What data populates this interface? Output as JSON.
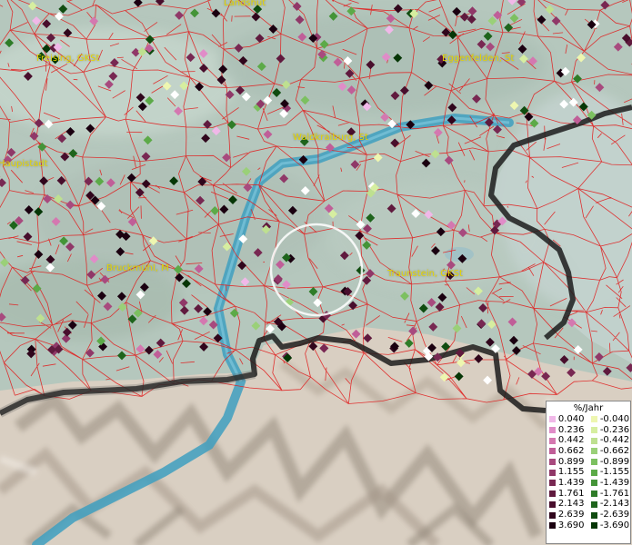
{
  "map": {
    "place_labels": [
      {
        "id": "landshut",
        "text": "Landshut"
      },
      {
        "id": "freising",
        "text": "Freising, GKSt"
      },
      {
        "id": "eggenfelden",
        "text": "Eggenfelden, St"
      },
      {
        "id": "waldkraiburg",
        "text": "Waldkraiburg, St"
      },
      {
        "id": "haupstadt",
        "text": "Haupistadt"
      },
      {
        "id": "bruckmuehl",
        "text": "Bruckmühl, M"
      },
      {
        "id": "traunstein",
        "text": "Traunstein, GKSt"
      }
    ],
    "colors": {
      "terrain_base": "#b8cac2",
      "boundary_lines": "#e02020",
      "river": "#3e9fc0",
      "state_border": "#1c1c1c",
      "selection_circle": "#ffffff"
    }
  },
  "legend": {
    "title": "%/Jahr",
    "rows": [
      {
        "pos": "0.040",
        "pos_color": "#f0b8e8",
        "neg": "-0.040",
        "neg_color": "#eef6b0"
      },
      {
        "pos": "0.236",
        "pos_color": "#e08cc8",
        "neg": "-0.236",
        "neg_color": "#d6eea0"
      },
      {
        "pos": "0.442",
        "pos_color": "#d478b0",
        "neg": "-0.442",
        "neg_color": "#bee090"
      },
      {
        "pos": "0.662",
        "pos_color": "#c05e98",
        "neg": "-0.662",
        "neg_color": "#9ad078"
      },
      {
        "pos": "0.899",
        "pos_color": "#a84a7e",
        "neg": "-0.899",
        "neg_color": "#7cc060"
      },
      {
        "pos": "1.155",
        "pos_color": "#903868",
        "neg": "-1.155",
        "neg_color": "#5caa48"
      },
      {
        "pos": "1.439",
        "pos_color": "#782852",
        "neg": "-1.439",
        "neg_color": "#449438"
      },
      {
        "pos": "1.761",
        "pos_color": "#601a3e",
        "neg": "-1.761",
        "neg_color": "#2e7c28"
      },
      {
        "pos": "2.143",
        "pos_color": "#480e2c",
        "neg": "-2.143",
        "neg_color": "#1e641c"
      },
      {
        "pos": "2.639",
        "pos_color": "#30061c",
        "neg": "-2.639",
        "neg_color": "#104c10"
      },
      {
        "pos": "3.690",
        "pos_color": "#1a0010",
        "neg": "-3.690",
        "neg_color": "#063606"
      }
    ]
  }
}
